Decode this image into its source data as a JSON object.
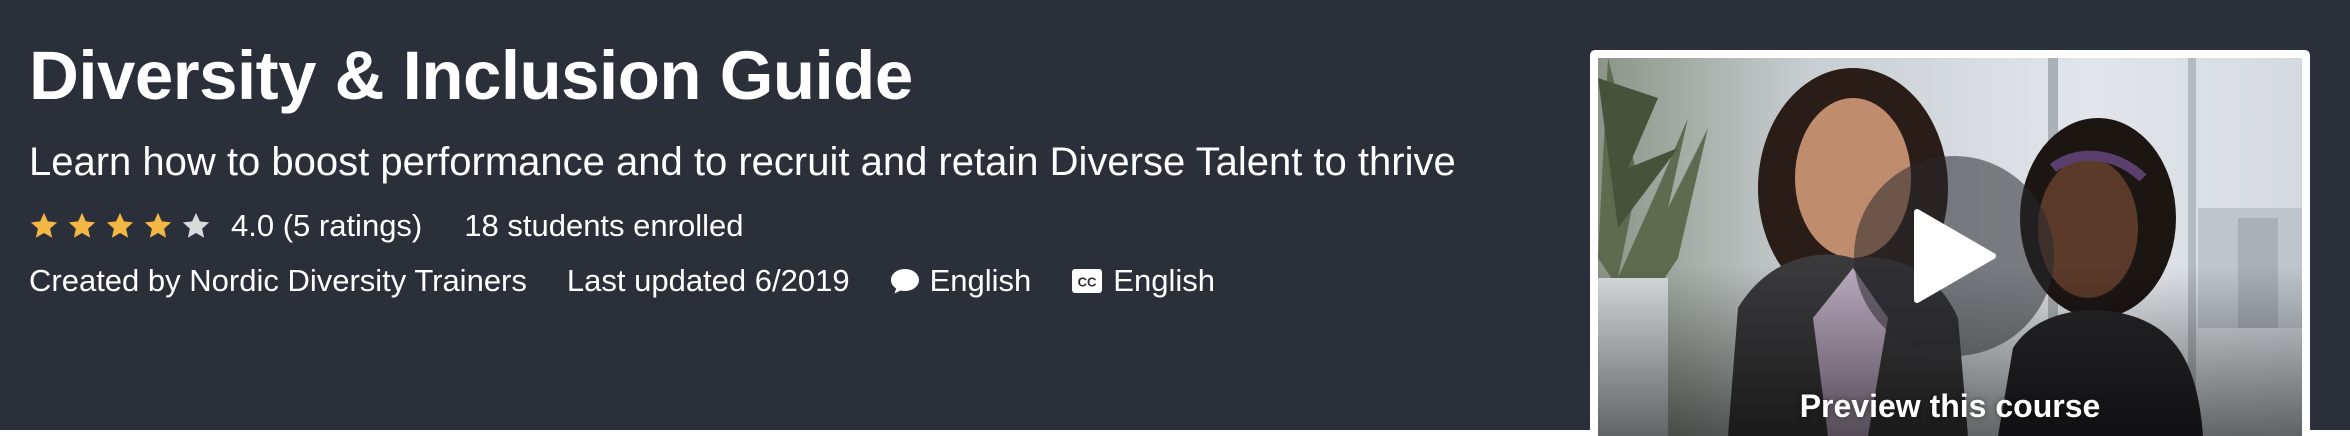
{
  "course": {
    "title": "Diversity & Inclusion Guide",
    "subtitle": "Learn how to boost performance and to recruit and retain Diverse Talent to thrive",
    "rating": 4.0,
    "rating_label": "4.0 (5 ratings)",
    "stars_filled": 4,
    "stars_total": 5,
    "students_label": "18 students enrolled",
    "created_by_label": "Created by Nordic Diversity Trainers",
    "last_updated_label": "Last updated 6/2019",
    "language_label": "English",
    "captions_label": "English"
  },
  "icons": {
    "star": "star-icon",
    "language": "speech-bubble-icon",
    "captions": "closed-captions-icon",
    "play": "play-icon"
  },
  "preview": {
    "label": "Preview this course"
  },
  "colors": {
    "hero_background": "#2b2f3a",
    "star_filled": "#f3b744",
    "star_empty": "#d9dadc",
    "text": "#ffffff"
  }
}
